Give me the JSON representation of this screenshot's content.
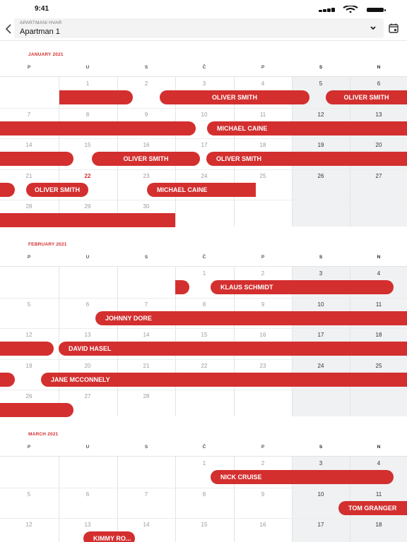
{
  "status_bar": {
    "time": "9:41"
  },
  "header": {
    "caption": "APARTMANI HVAR",
    "selected": "Apartman 1"
  },
  "weekdays": [
    "P",
    "U",
    "S",
    "Č",
    "P",
    "S",
    "N"
  ],
  "colors": {
    "accent": "#d32f2f",
    "weekend_bg": "#f0f1f2"
  },
  "months": [
    {
      "title": "JANUARY 2021",
      "weeks": [
        [
          "",
          "",
          "",
          "",
          "1",
          "2",
          "3",
          "4",
          "5",
          "6"
        ],
        [
          "7",
          "8",
          "9",
          "10",
          "11",
          "12",
          "13"
        ],
        [
          "14",
          "15",
          "16",
          "17",
          "18",
          "19",
          "20"
        ],
        [
          "21",
          "22",
          "23",
          "24",
          "25",
          "26",
          "27"
        ],
        [
          "28",
          "29",
          "30",
          "",
          "",
          "",
          ""
        ]
      ],
      "bookings": [
        {
          "guest": "OLIVER SMITH"
        },
        {
          "guest": "OLIVER SMITH"
        },
        {
          "guest": "MICHAEL CAINE"
        },
        {
          "guest": "OLIVER SMITH"
        },
        {
          "guest": "OLIVER SMITH"
        },
        {
          "guest": "OLIVER SMITH"
        },
        {
          "guest": "MICHAEL CAINE"
        }
      ]
    },
    {
      "title": "FEBRUARY 2021",
      "bookings": [
        {
          "guest": "KLAUS SCHMIDT"
        },
        {
          "guest": "JOHNNY DORE"
        },
        {
          "guest": "DAVID HASEL"
        },
        {
          "guest": "JANE MCCONNELY"
        }
      ]
    },
    {
      "title": "MARCH 2021",
      "bookings": [
        {
          "guest": "NICK CRUISE"
        },
        {
          "guest": "TOM GRANGER"
        },
        {
          "guest": "KIMMY RO..."
        }
      ]
    }
  ],
  "icons": {
    "back": "chevron-left-icon",
    "dropdown": "chevron-down-icon",
    "calendar": "calendar-icon"
  }
}
